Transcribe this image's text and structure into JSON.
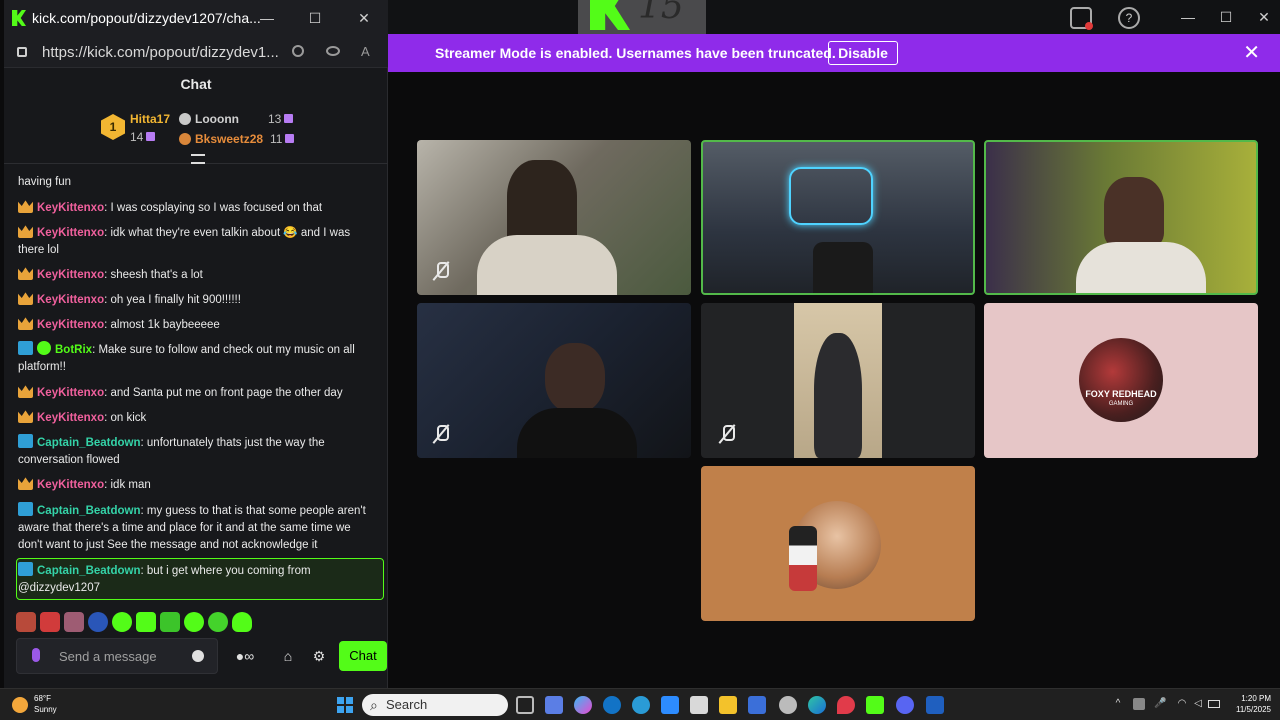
{
  "main_window": {
    "minimize": "—",
    "maximize": "☐",
    "close": "✕",
    "help_icon": "?"
  },
  "logo_overlay": {
    "number": "15"
  },
  "banner": {
    "text": "Streamer Mode is enabled. Usernames have been truncated.",
    "disable_label": "Disable",
    "close": "✕"
  },
  "tiles": [
    {
      "name": "participant-1",
      "muted": true,
      "active": false,
      "bg": "#6d6a63"
    },
    {
      "name": "participant-2",
      "muted": false,
      "active": true,
      "bg": "#3a3f4a"
    },
    {
      "name": "participant-3",
      "muted": false,
      "active": true,
      "bg": "#5b6b3b"
    },
    {
      "name": "participant-4",
      "muted": true,
      "active": false,
      "bg": "#1d2330"
    },
    {
      "name": "participant-5",
      "muted": true,
      "active": false,
      "bg": "#2a2a2c"
    },
    {
      "name": "participant-6",
      "muted": false,
      "active": false,
      "bg": "#e4c8c8",
      "avatar_text_line1": "FOXY REDHEAD",
      "avatar_text_line2": "GAMING"
    },
    {
      "name": "participant-7",
      "muted": false,
      "active": false,
      "bg": "#c0804a"
    }
  ],
  "chat_window": {
    "title": "kick.com/popout/dizzydev1207/cha...",
    "minimize": "—",
    "maximize": "☐",
    "close": "✕",
    "url": "https://kick.com/popout/dizzydev1...",
    "header": "Chat"
  },
  "leaderboard": {
    "rank": "1",
    "first": {
      "name": "Hitta17",
      "count": "14"
    },
    "second": {
      "name": "Looonn",
      "count": "13"
    },
    "third": {
      "name": "Bksweetz28",
      "count": "11"
    }
  },
  "messages": [
    {
      "badge": "none",
      "user": "",
      "color": "pink",
      "text": "having fun"
    },
    {
      "badge": "crown",
      "user": "KeyKittenxo",
      "color": "pink",
      "text": ": I was cosplaying so I was focused on that"
    },
    {
      "badge": "crown",
      "user": "KeyKittenxo",
      "color": "pink",
      "text": ": idk what they're even talkin about 😂 and I was there lol"
    },
    {
      "badge": "crown",
      "user": "KeyKittenxo",
      "color": "pink",
      "text": ": sheesh that's a lot"
    },
    {
      "badge": "crown",
      "user": "KeyKittenxo",
      "color": "pink",
      "text": ": oh yea I finally hit 900!!!!!!"
    },
    {
      "badge": "crown",
      "user": "KeyKittenxo",
      "color": "pink",
      "text": ": almost 1k baybeeeee"
    },
    {
      "badge": "bot",
      "user": "BotRix",
      "color": "green",
      "text": ": Make sure to follow and check out my music on all platform!!"
    },
    {
      "badge": "crown",
      "user": "KeyKittenxo",
      "color": "pink",
      "text": ": and Santa put me on front page the other day"
    },
    {
      "badge": "crown",
      "user": "KeyKittenxo",
      "color": "pink",
      "text": ": on kick"
    },
    {
      "badge": "mod",
      "user": "Captain_Beatdown",
      "color": "teal",
      "text": ": unfortunately thats just the way the conversation flowed"
    },
    {
      "badge": "crown",
      "user": "KeyKittenxo",
      "color": "pink",
      "text": ": idk man"
    },
    {
      "badge": "mod",
      "user": "Captain_Beatdown",
      "color": "teal",
      "text": ": my guess to that is that some people aren't aware that there's a time and place for it and at the same time we don't want to just See the message and not acknowledge it"
    },
    {
      "badge": "mod",
      "user": "Captain_Beatdown",
      "color": "teal",
      "text": ": but i get where you coming from @dizzydev1207"
    }
  ],
  "input": {
    "placeholder": "Send a message",
    "send_label": "Chat"
  },
  "taskbar": {
    "weather_temp": "68°F",
    "weather_cond": "Sunny",
    "search_label": "Search",
    "time": "1:20 PM",
    "date": "11/5/2025"
  }
}
